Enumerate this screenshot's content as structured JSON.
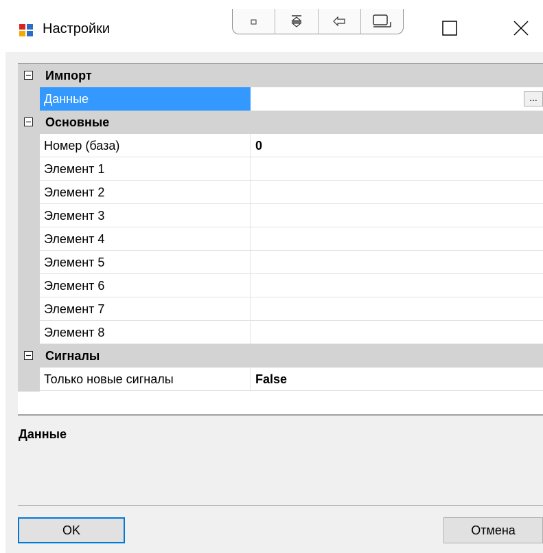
{
  "window": {
    "title": "Настройки",
    "tool_buttons": [
      "dot-icon",
      "split-top-icon",
      "dock-left-icon",
      "dock-bottom-icon"
    ]
  },
  "property_grid": {
    "categories": [
      {
        "name": "Импорт",
        "expanded": true,
        "properties": [
          {
            "name": "Данные",
            "value": "",
            "selected": true,
            "button": "..."
          }
        ]
      },
      {
        "name": "Основные",
        "expanded": true,
        "properties": [
          {
            "name": "Номер (база)",
            "value": "0",
            "bold": true
          },
          {
            "name": "Элемент 1",
            "value": ""
          },
          {
            "name": "Элемент 2",
            "value": ""
          },
          {
            "name": "Элемент 3",
            "value": ""
          },
          {
            "name": "Элемент 4",
            "value": ""
          },
          {
            "name": "Элемент 5",
            "value": ""
          },
          {
            "name": "Элемент 6",
            "value": ""
          },
          {
            "name": "Элемент 7",
            "value": ""
          },
          {
            "name": "Элемент 8",
            "value": ""
          }
        ]
      },
      {
        "name": "Сигналы",
        "expanded": true,
        "properties": [
          {
            "name": "Только новые сигналы",
            "value": "False",
            "bold": true
          }
        ]
      }
    ]
  },
  "help": {
    "title": "Данные",
    "description": ""
  },
  "buttons": {
    "ok": "OK",
    "cancel": "Отмена"
  },
  "colors": {
    "selection": "#3399ff",
    "focus_border": "#0078d7",
    "category_bg": "#d3d3d3"
  }
}
